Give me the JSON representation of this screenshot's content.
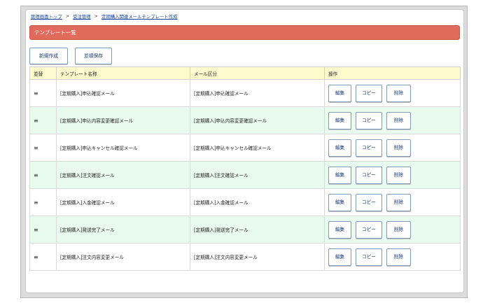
{
  "breadcrumb": {
    "items": [
      "管理画面トップ",
      "受注管理",
      "定期購入関連メールテンプレート作成"
    ],
    "separator": ">"
  },
  "title": "テンプレート一覧",
  "toolbar": {
    "new_label": "新規作成",
    "save_order_label": "並順保存"
  },
  "table": {
    "headers": [
      "並替",
      "テンプレート名称",
      "メール区分",
      "操作"
    ],
    "handle_icon": "≡",
    "rows": [
      {
        "name": "[定期購入]申込確認メール",
        "category": "[定期購入]申込確認メール"
      },
      {
        "name": "[定期購入]申込内容変更確認メール",
        "category": "[定期購入]申込内容変更確認メール"
      },
      {
        "name": "[定期購入]申込キャンセル確認メール",
        "category": "[定期購入]申込キャンセル確認メール"
      },
      {
        "name": "[定期購入]注文確認メール",
        "category": "[定期購入]注文確認メール"
      },
      {
        "name": "[定期購入]入金確認メール",
        "category": "[定期購入]入金確認メール"
      },
      {
        "name": "[定期購入]発送完了メール",
        "category": "[定期購入]発送完了メール"
      },
      {
        "name": "[定期購入]注文内容変更メール",
        "category": "[定期購入]注文内容変更メール"
      }
    ],
    "actions": {
      "edit": "編集",
      "copy": "コピー",
      "delete": "削除"
    }
  },
  "colors": {
    "title_bar": "#e06a5c",
    "header_row": "#fdfbcd",
    "alt_row": "#e9fbee",
    "button_text": "#1f3a7a"
  }
}
